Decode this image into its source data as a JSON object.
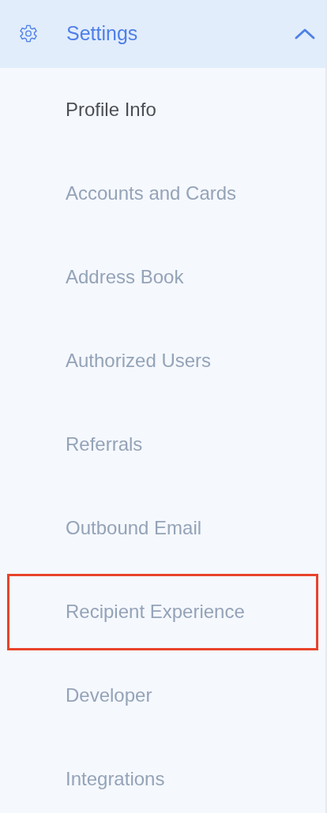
{
  "section": {
    "title": "Settings",
    "expanded": true
  },
  "items": [
    {
      "label": "Profile Info",
      "selected": true,
      "highlighted": false
    },
    {
      "label": "Accounts and Cards",
      "selected": false,
      "highlighted": false
    },
    {
      "label": "Address Book",
      "selected": false,
      "highlighted": false
    },
    {
      "label": "Authorized Users",
      "selected": false,
      "highlighted": false
    },
    {
      "label": "Referrals",
      "selected": false,
      "highlighted": false
    },
    {
      "label": "Outbound Email",
      "selected": false,
      "highlighted": false
    },
    {
      "label": "Recipient Experience",
      "selected": false,
      "highlighted": true
    },
    {
      "label": "Developer",
      "selected": false,
      "highlighted": false
    },
    {
      "label": "Integrations",
      "selected": false,
      "highlighted": false
    }
  ]
}
